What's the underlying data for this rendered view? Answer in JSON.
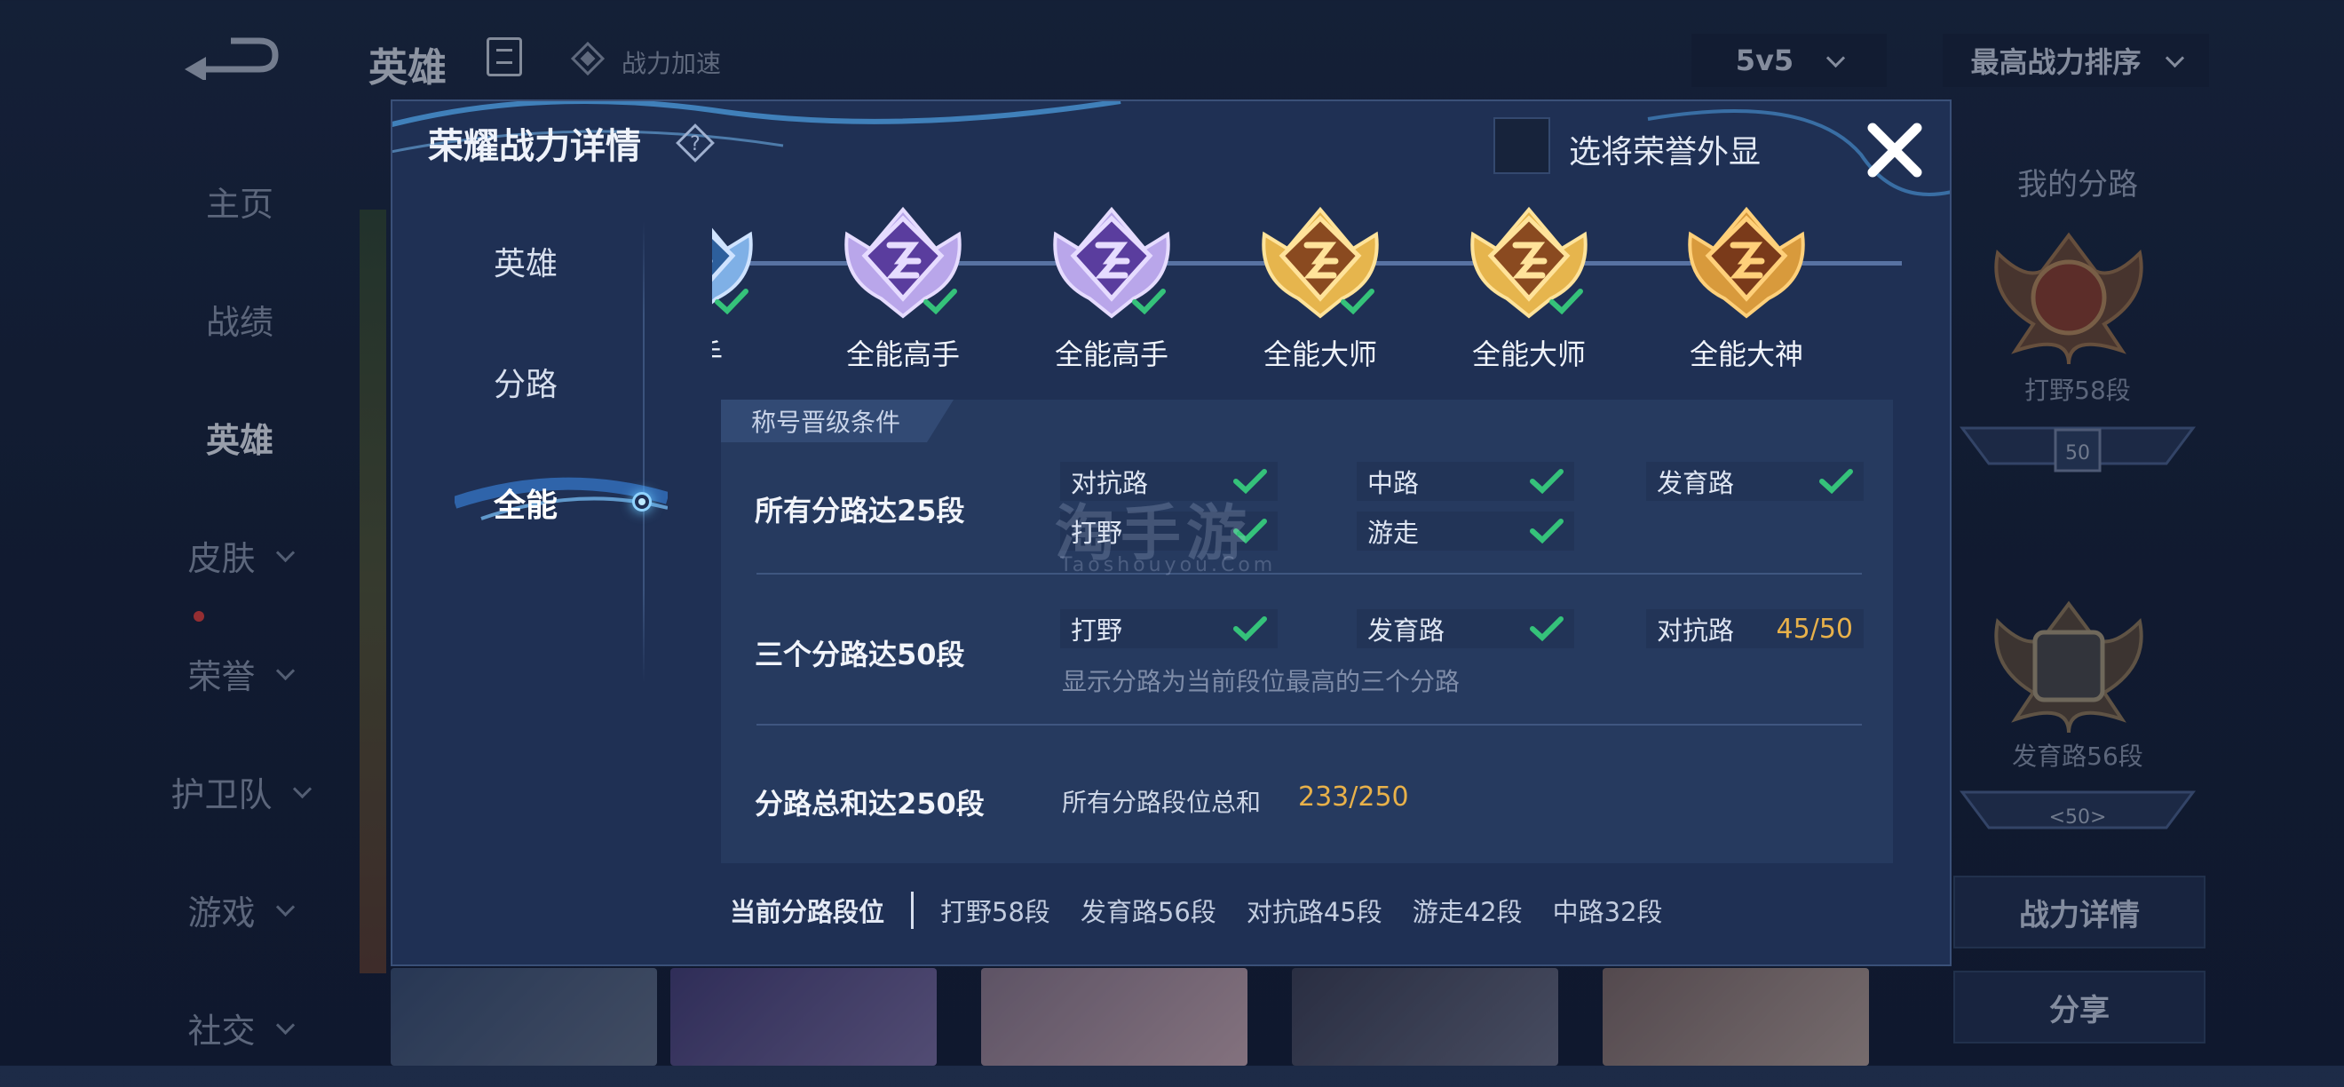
{
  "background": {
    "page_title": "英雄",
    "boost_label": "战力加速",
    "mode_select": "5v5",
    "sort_select": "最高战力排序",
    "side_nav": [
      "主页",
      "战绩",
      "英雄",
      "皮肤",
      "荣誉",
      "护卫队",
      "游戏",
      "社交"
    ],
    "right_panel": {
      "title": "我的分路",
      "rank1": "打野58段",
      "rank2": "发育路56段",
      "badge": "50",
      "badge2": "<50>",
      "detail_button": "战力详情",
      "share_button": "分享"
    }
  },
  "modal": {
    "title": "荣耀战力详情",
    "show_honor_label": "选将荣誉外显",
    "tabs": [
      "英雄",
      "分路",
      "全能"
    ],
    "active_tab": "全能",
    "ranks": [
      {
        "name": "选手",
        "tier": "blue",
        "completed": true
      },
      {
        "name": "全能高手",
        "tier": "purple",
        "completed": true
      },
      {
        "name": "全能高手",
        "tier": "purple",
        "completed": true
      },
      {
        "name": "全能大师",
        "tier": "gold",
        "completed": true
      },
      {
        "name": "全能大师",
        "tier": "gold",
        "completed": true
      },
      {
        "name": "全能大神",
        "tier": "bronze",
        "completed": false
      }
    ],
    "conditions": {
      "header": "称号晋级条件",
      "row1": {
        "title": "所有分路达25段",
        "items": [
          {
            "label": "对抗路",
            "done": true
          },
          {
            "label": "中路",
            "done": true
          },
          {
            "label": "发育路",
            "done": true
          },
          {
            "label": "打野",
            "done": true
          },
          {
            "label": "游走",
            "done": true
          }
        ]
      },
      "row2": {
        "title": "三个分路达50段",
        "items": [
          {
            "label": "打野",
            "done": true
          },
          {
            "label": "发育路",
            "done": true
          },
          {
            "label": "对抗路",
            "progress": "45/50"
          }
        ],
        "note": "显示分路为当前段位最高的三个分路"
      },
      "row3": {
        "title": "分路总和达250段",
        "label": "所有分路段位总和",
        "progress": "233/250"
      }
    },
    "watermark": "淘手游",
    "watermark_sub": "Taoshouyou.Com",
    "footer": {
      "label": "当前分路段位",
      "items": [
        "打野58段",
        "发育路56段",
        "对抗路45段",
        "游走42段",
        "中路32段"
      ]
    },
    "colors": {
      "accent_gold": "#e8b14a",
      "check_green": "#35c27a",
      "panel": "#263a5f"
    }
  }
}
